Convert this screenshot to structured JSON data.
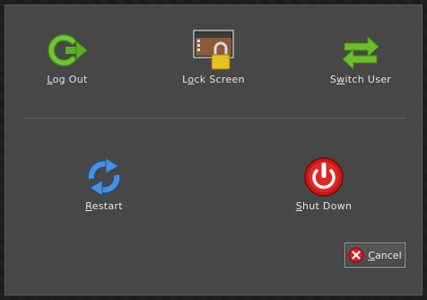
{
  "actions": {
    "logout": {
      "pre": "",
      "key": "L",
      "post": "og Out",
      "icon": "logout-icon"
    },
    "lock": {
      "pre": "L",
      "key": "o",
      "post": "ck Screen",
      "icon": "lock-screen-icon"
    },
    "switch_user": {
      "pre": "S",
      "key": "w",
      "post": "itch User",
      "icon": "switch-user-icon"
    },
    "restart": {
      "pre": "",
      "key": "R",
      "post": "estart",
      "icon": "restart-icon"
    },
    "shutdown": {
      "pre": "",
      "key": "S",
      "post": "hut Down",
      "icon": "shutdown-icon"
    }
  },
  "cancel": {
    "pre": "",
    "key": "C",
    "post": "ancel",
    "icon": "cancel-icon"
  },
  "colors": {
    "background": "#474747",
    "text": "#e4e4e4",
    "green": "#5fae2a",
    "blue": "#3a7fd0",
    "red": "#d01c1c"
  }
}
